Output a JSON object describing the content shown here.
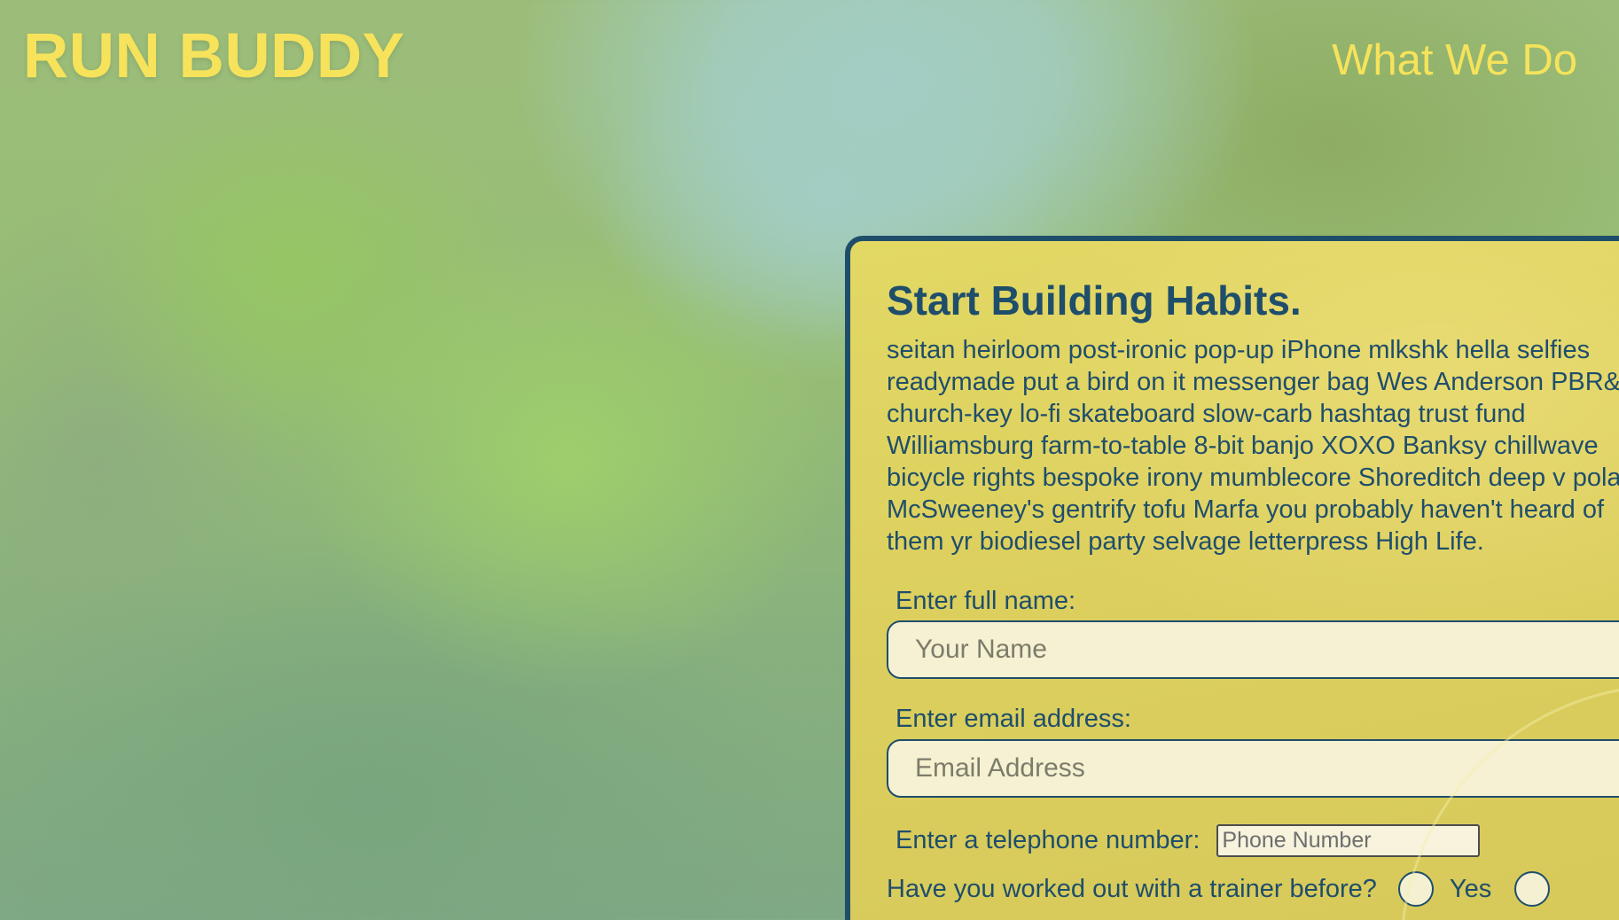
{
  "header": {
    "brand": "RUN BUDDY",
    "nav_link": "What We Do"
  },
  "signup": {
    "title": "Start Building Habits.",
    "body": "seitan heirloom post-ironic pop-up iPhone mlkshk hella selfies readymade put a bird on it messenger bag Wes Anderson PBR&B church-key lo-fi skateboard slow-carb hashtag trust fund Williamsburg farm-to-table 8-bit banjo XOXO Banksy chillwave bicycle rights bespoke irony mumblecore Shoreditch deep v polaroid McSweeney's gentrify tofu Marfa you probably haven't heard of them yr biodiesel party selvage letterpress High Life.",
    "name_label": "Enter full name:",
    "name_placeholder": "Your Name",
    "email_label": "Enter email address:",
    "email_placeholder": "Email Address",
    "phone_label": "Enter a telephone number:",
    "phone_placeholder": "Phone Number",
    "trainer_question": "Have you worked out with a trainer before?",
    "trainer_yes": "Yes"
  },
  "colors": {
    "brand_yellow": "#f6e35b",
    "panel_yellow": "#dccf5e",
    "navy": "#1f4e6b",
    "input_bg": "#f6f1d2"
  }
}
